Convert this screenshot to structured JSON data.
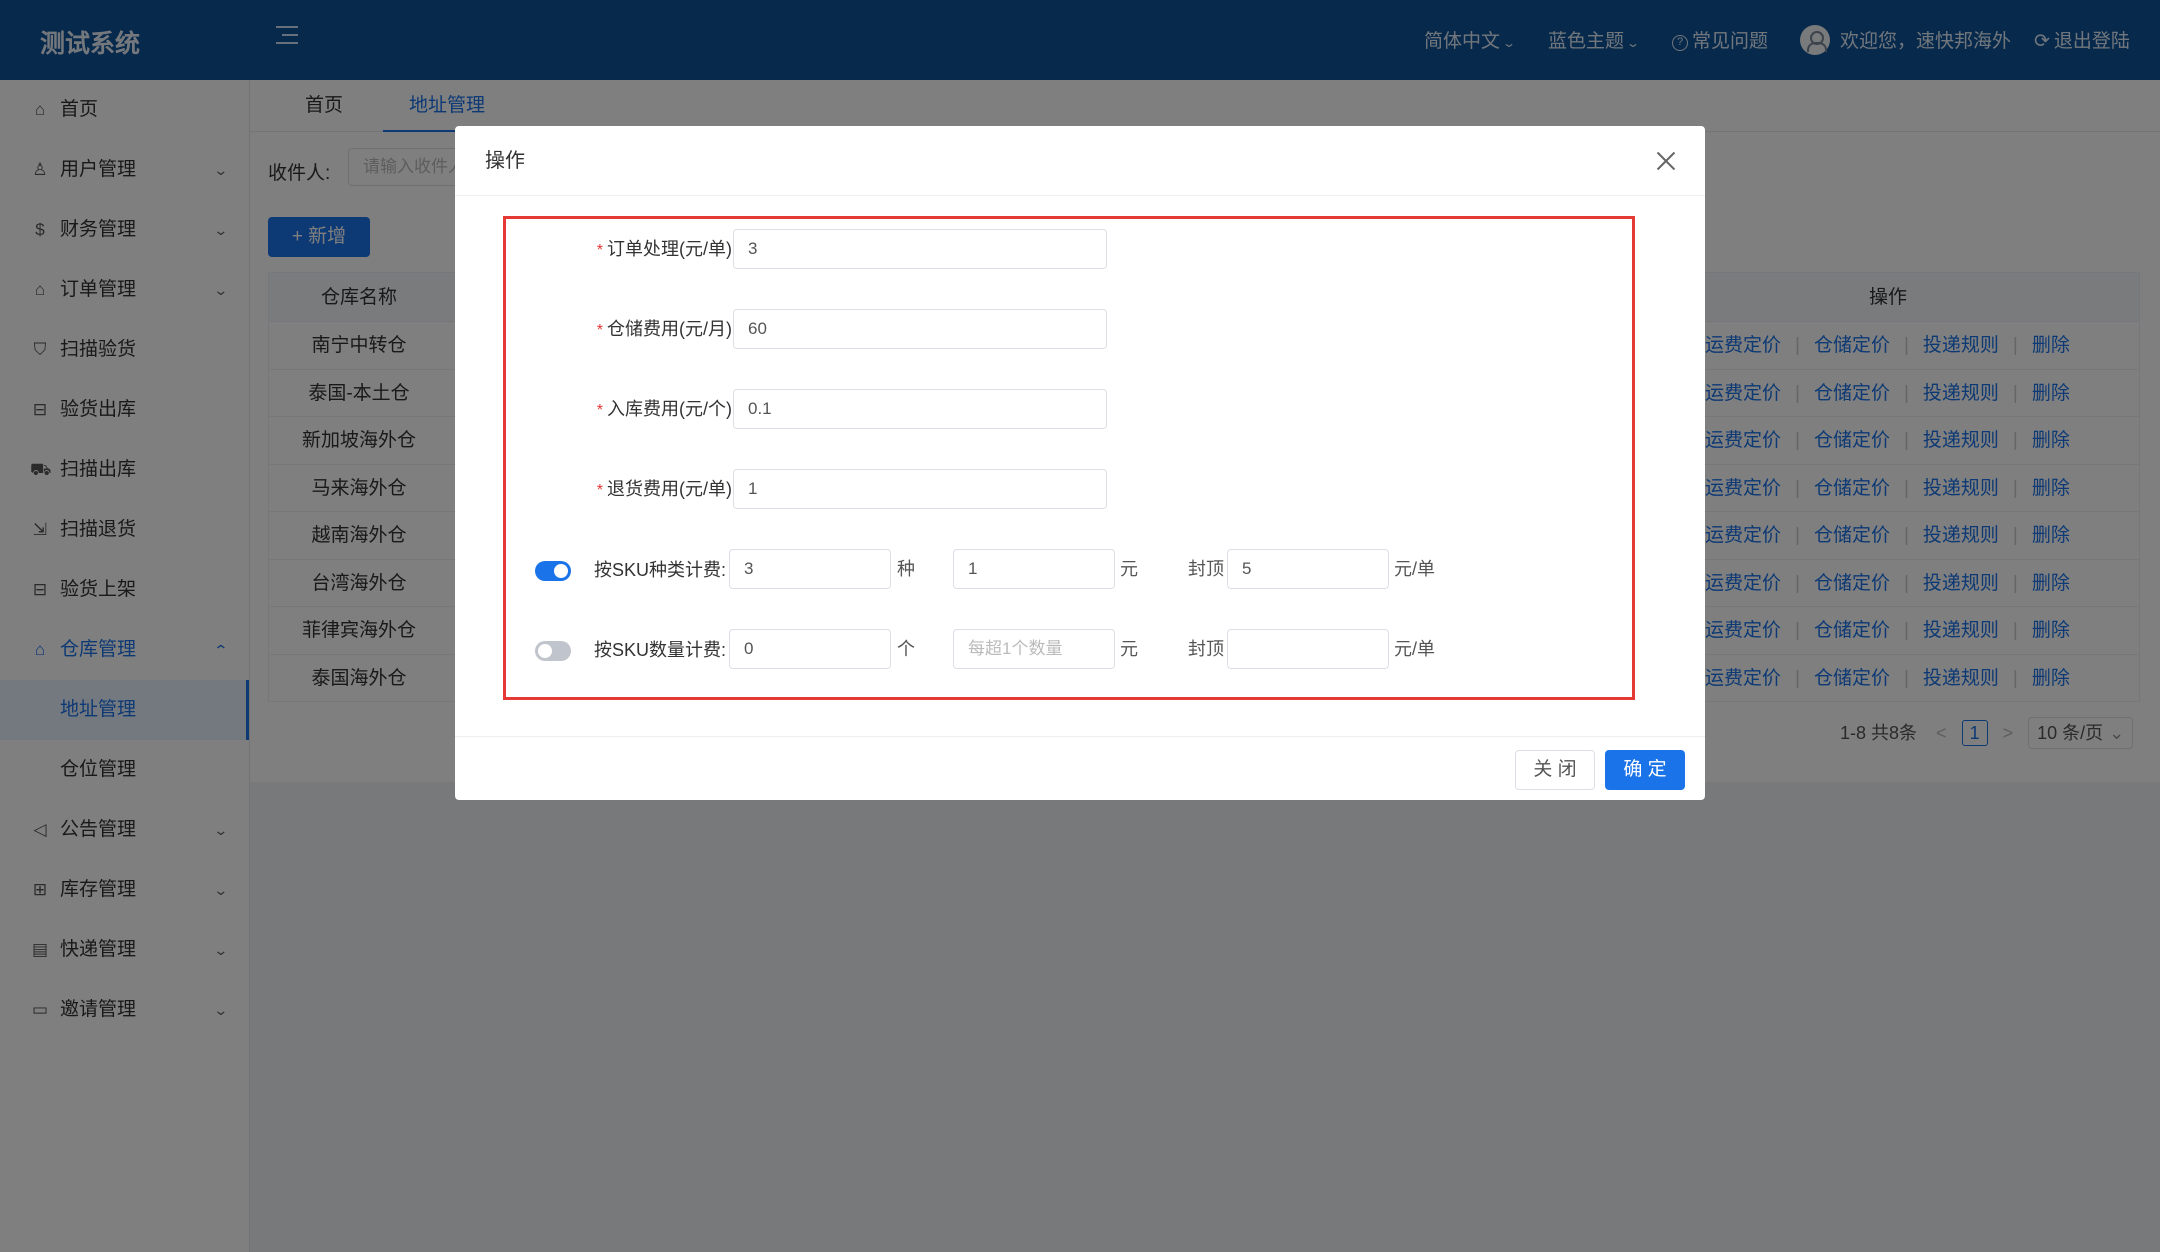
{
  "header": {
    "logo": "测试系统",
    "language": "简体中文",
    "theme": "蓝色主题",
    "faq": "常见问题",
    "faq_icon": "?",
    "welcome": "欢迎您，速快邦海外",
    "logout": "退出登陆",
    "logout_icon": "⟳"
  },
  "sidebar": {
    "items": [
      {
        "label": "首页",
        "icon": "⌂"
      },
      {
        "label": "用户管理",
        "icon": "♙",
        "arrow": "⌄"
      },
      {
        "label": "财务管理",
        "icon": "$",
        "arrow": "⌄"
      },
      {
        "label": "订单管理",
        "icon": "⌂",
        "arrow": "⌄"
      },
      {
        "label": "扫描验货",
        "icon": "⛉"
      },
      {
        "label": "验货出库",
        "icon": "⊟"
      },
      {
        "label": "扫描出库",
        "icon": "⛟"
      },
      {
        "label": "扫描退货",
        "icon": "⇲"
      },
      {
        "label": "验货上架",
        "icon": "⊟"
      },
      {
        "label": "仓库管理",
        "icon": "⌂",
        "arrow": "⌃"
      },
      {
        "label": "公告管理",
        "icon": "◁",
        "arrow": "⌄"
      },
      {
        "label": "库存管理",
        "icon": "⊞",
        "arrow": "⌄"
      },
      {
        "label": "快递管理",
        "icon": "▤",
        "arrow": "⌄"
      },
      {
        "label": "邀请管理",
        "icon": "▭",
        "arrow": "⌄"
      }
    ],
    "submenu": [
      {
        "label": "地址管理"
      },
      {
        "label": "仓位管理"
      }
    ]
  },
  "tabs": [
    {
      "label": "首页"
    },
    {
      "label": "地址管理"
    }
  ],
  "filter": {
    "label": "收件人:",
    "placeholder": "请输入收件人"
  },
  "add_button": "+ 新增",
  "table": {
    "col_name": "仓库名称",
    "col_ops": "操作",
    "ops": [
      "运费定价",
      "仓储定价",
      "投递规则",
      "删除"
    ],
    "rows": [
      {
        "name": "南宁中转仓"
      },
      {
        "name": "泰国-本土仓"
      },
      {
        "name": "新加坡海外仓"
      },
      {
        "name": "马来海外仓"
      },
      {
        "name": "越南海外仓"
      },
      {
        "name": "台湾海外仓"
      },
      {
        "name": "菲律宾海外仓"
      },
      {
        "name": "泰国海外仓"
      }
    ]
  },
  "pagination": {
    "range": "1-8 共8条",
    "current": "1",
    "prev": "<",
    "next": ">",
    "size": "10 条/页",
    "size_caret": "⌄"
  },
  "modal": {
    "title": "操作",
    "required_mark": "*",
    "fields": [
      {
        "label": "订单处理(元/单):",
        "value": "3"
      },
      {
        "label": "仓储费用(元/月):",
        "value": "60"
      },
      {
        "label": "入库费用(元/个):",
        "value": "0.1"
      },
      {
        "label": "退货费用(元/单):",
        "value": "1"
      }
    ],
    "sku_type": {
      "enabled": true,
      "label": "按SKU种类计费:",
      "count": "3",
      "count_unit": "种",
      "price": "1",
      "price_unit": "元",
      "cap_label": "封顶",
      "cap": "5",
      "cap_unit": "元/单"
    },
    "sku_qty": {
      "enabled": false,
      "label": "按SKU数量计费:",
      "count": "0",
      "count_unit": "个",
      "price": "",
      "price_placeholder": "每超1个数量",
      "price_unit": "元",
      "cap_label": "封顶",
      "cap": "",
      "cap_unit": "元/单"
    },
    "close_button": "关 闭",
    "ok_button": "确 定"
  },
  "colors": {
    "header_bg": "#0e5399",
    "primary": "#1a73e8",
    "highlight_frame": "#e53935"
  }
}
